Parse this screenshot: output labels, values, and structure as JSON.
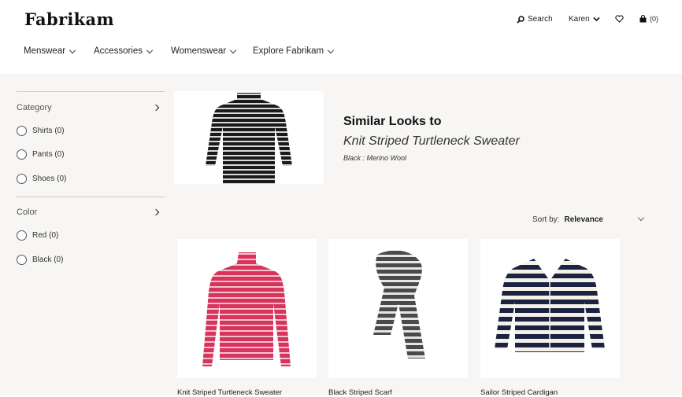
{
  "brand": {
    "logo": "Fabrikam"
  },
  "utility": {
    "search_label": "Search",
    "account_label": "Karen",
    "cart_count": "(0)"
  },
  "nav": [
    {
      "label": "Menswear"
    },
    {
      "label": "Accessories"
    },
    {
      "label": "Womenswear"
    },
    {
      "label": "Explore Fabrikam"
    }
  ],
  "filters": {
    "category": {
      "title": "Category",
      "options": [
        "Shirts (0)",
        "Pants (0)",
        "Shoes (0)"
      ]
    },
    "color": {
      "title": "Color",
      "options": [
        "Red (0)",
        "Black (0)"
      ]
    }
  },
  "hero": {
    "title": "Similar Looks to",
    "product": "Knit Striped Turtleneck Sweater",
    "meta": "Black : Merino Wool"
  },
  "sort": {
    "label": "Sort by:",
    "value": "Relevance"
  },
  "products": [
    {
      "name": "Knit Striped Turtleneck Sweater",
      "color": "#d8335b"
    },
    {
      "name": "Black Striped Scarf",
      "color": "#555555"
    },
    {
      "name": "Sailor Striped Cardigan",
      "color": "#1c2340"
    }
  ]
}
